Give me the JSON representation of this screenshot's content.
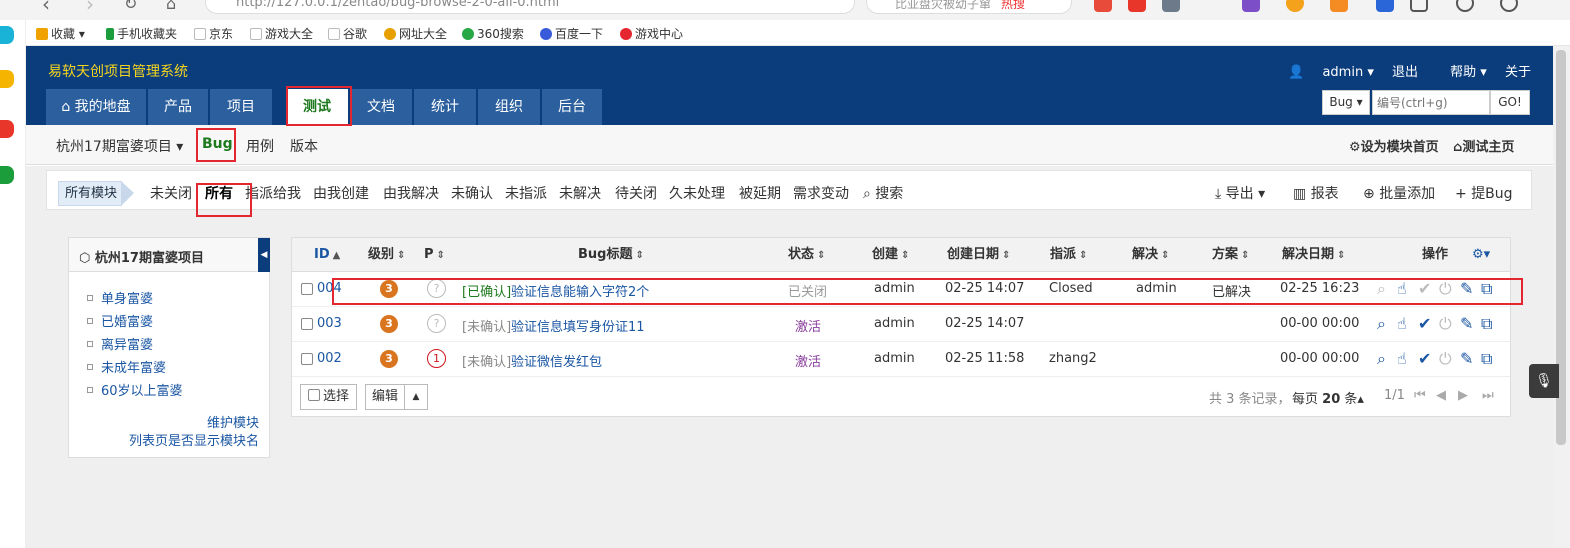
{
  "browser": {
    "url": "http://127.0.0.1/zentao/bug-browse-2-0-all-0.html",
    "search_placeholder": "比亚盘灾被幼子窜",
    "search_hot": "热搜"
  },
  "bookmarks": [
    {
      "label": "收藏",
      "color": "#f0a200"
    },
    {
      "label": "手机收藏夹",
      "color": "#1c9d3c"
    },
    {
      "label": "京东",
      "color": "#cccccc"
    },
    {
      "label": "游戏大全",
      "color": "#cccccc"
    },
    {
      "label": "谷歌",
      "color": "#cccccc"
    },
    {
      "label": "网址大全",
      "color": "#e8a000"
    },
    {
      "label": "360搜索",
      "color": "#27a845"
    },
    {
      "label": "百度一下",
      "color": "#3a5bd9"
    },
    {
      "label": "游戏中心",
      "color": "#e3262f"
    }
  ],
  "header": {
    "app_title": "易软天创项目管理系统",
    "user": "admin",
    "logout": "退出",
    "help": "帮助",
    "about": "关于",
    "nav": [
      {
        "label": "我的地盘",
        "active": false
      },
      {
        "label": "产品",
        "active": false
      },
      {
        "label": "项目",
        "active": false
      },
      {
        "label": "测试",
        "active": true
      },
      {
        "label": "文档",
        "active": false
      },
      {
        "label": "统计",
        "active": false
      },
      {
        "label": "组织",
        "active": false
      },
      {
        "label": "后台",
        "active": false
      }
    ],
    "quicksearch": {
      "type": "Bug",
      "placeholder": "编号(ctrl+g)",
      "go": "GO!"
    }
  },
  "subnav": {
    "product": "杭州17期富婆项目",
    "items": [
      "Bug",
      "用例",
      "版本"
    ],
    "right": [
      "设为模块首页",
      "测试主页"
    ]
  },
  "featurebar": {
    "all_modules": "所有模块",
    "filters": [
      "未关闭",
      "所有",
      "指派给我",
      "由我创建",
      "由我解决",
      "未确认",
      "未指派",
      "未解决",
      "待关闭",
      "久未处理",
      "被延期",
      "需求变动",
      "搜索"
    ],
    "actions": [
      "导出",
      "报表",
      "批量添加",
      "提Bug"
    ]
  },
  "tree": {
    "title": "杭州17期富婆项目",
    "modules": [
      "单身富婆",
      "已婚富婆",
      "离异富婆",
      "未成年富婆",
      "60岁以上富婆"
    ],
    "links": [
      "维护模块",
      "列表页是否显示模块名"
    ]
  },
  "table": {
    "columns": [
      "ID",
      "级别",
      "P",
      "Bug标题",
      "状态",
      "创建",
      "创建日期",
      "指派",
      "解决",
      "方案",
      "解决日期",
      "操作"
    ],
    "rows": [
      {
        "id": "004",
        "severity": "3",
        "pri": "?",
        "tag": "[已确认]",
        "title": "验证信息能输入字符2个",
        "status": "已关闭",
        "creator": "admin",
        "created": "02-25 14:07",
        "assigned": "Closed",
        "resolver": "admin",
        "resolution": "已解决",
        "resolved_date": "02-25 16:23",
        "closed": true
      },
      {
        "id": "003",
        "severity": "3",
        "pri": "?",
        "tag": "[未确认]",
        "title": "验证信息填写身份证11",
        "status": "激活",
        "creator": "admin",
        "created": "02-25 14:07",
        "assigned": "",
        "resolver": "",
        "resolution": "",
        "resolved_date": "00-00 00:00",
        "closed": false
      },
      {
        "id": "002",
        "severity": "3",
        "pri": "1",
        "tag": "[未确认]",
        "title": "验证微信发红包",
        "status": "激活",
        "creator": "admin",
        "created": "02-25 11:58",
        "assigned": "zhang2",
        "resolver": "",
        "resolution": "",
        "resolved_date": "00-00 00:00",
        "closed": false
      }
    ],
    "footer": {
      "select": "选择",
      "edit": "编辑",
      "summary": "共 3 条记录，",
      "per_page_prefix": "每页",
      "per_page": "20",
      "per_page_suffix": "条",
      "pages": "1/1"
    }
  },
  "colors": {
    "header": "#0b3d7d",
    "accent": "#1f7a1f",
    "link": "#1a56a3",
    "highlight": "#e3262f",
    "severity": "#d9751f"
  }
}
